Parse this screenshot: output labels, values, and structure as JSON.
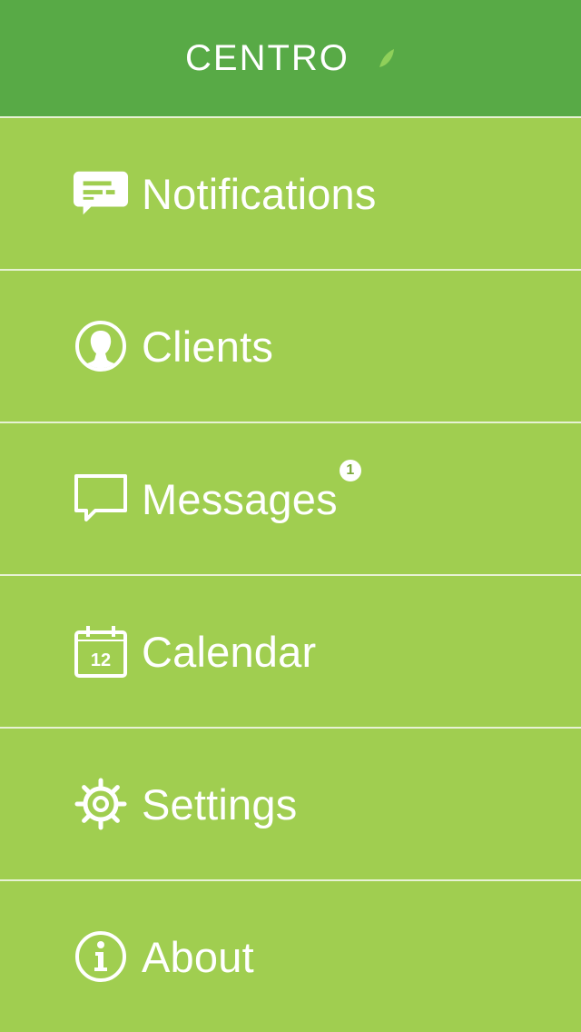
{
  "header": {
    "logo_text": "CENTRO"
  },
  "menu": {
    "items": [
      {
        "label": "Notifications",
        "icon": "notification-card-icon"
      },
      {
        "label": "Clients",
        "icon": "person-circle-icon"
      },
      {
        "label": "Messages",
        "icon": "speech-bubble-icon",
        "badge": "1"
      },
      {
        "label": "Calendar",
        "icon": "calendar-icon",
        "icon_text": "12"
      },
      {
        "label": "Settings",
        "icon": "gear-icon"
      },
      {
        "label": "About",
        "icon": "info-icon"
      }
    ]
  },
  "colors": {
    "header_bg": "#58aa46",
    "menu_bg": "#a0ce50",
    "divider": "#e7f2d4",
    "text": "#ffffff",
    "badge_text": "#7aa83a"
  }
}
